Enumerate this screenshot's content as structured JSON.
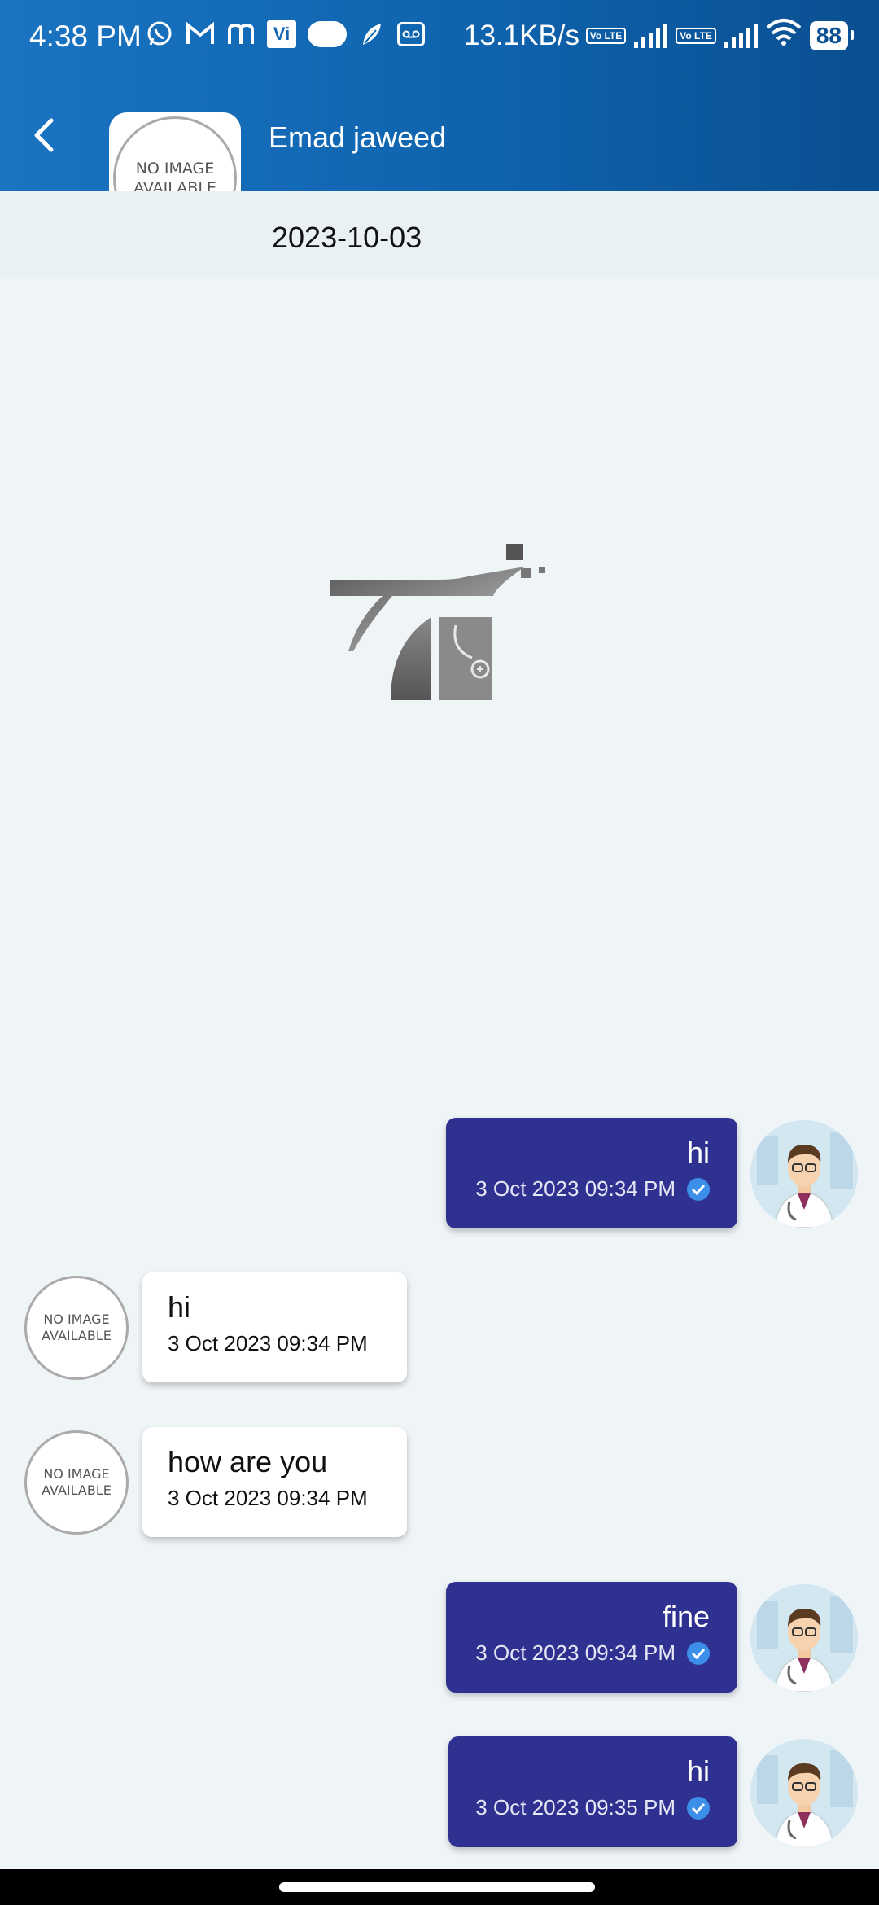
{
  "status": {
    "time": "4:38 PM",
    "network_speed": "13.1KB/s",
    "battery": "88",
    "vi_label": "Vi",
    "volte_label": "Vo LTE",
    "icons": [
      "whatsapp-icon",
      "gmail-icon",
      "m-app-icon",
      "vi-icon",
      "pill-icon",
      "feather-icon",
      "voicemail-icon",
      "volte-icon",
      "signal-icon",
      "wifi-icon",
      "battery-icon"
    ]
  },
  "header": {
    "back_icon": "chevron-left-icon",
    "contact_name": "Emad jaweed",
    "avatar_placeholder_line1": "NO IMAGE",
    "avatar_placeholder_line2": "AVAILABLE",
    "date": "2023-10-03"
  },
  "colors": {
    "header_gradient_start": "#1a74c2",
    "header_gradient_end": "#0a4f91",
    "background": "#eff4f7",
    "outgoing_bubble": "#2e3190",
    "incoming_bubble": "#ffffff",
    "read_check": "#3b8fe8"
  },
  "messages": [
    {
      "direction": "outgoing",
      "text": "hi",
      "time": "3 Oct 2023 09:34 PM",
      "read": true
    },
    {
      "direction": "incoming",
      "text": "hi",
      "time": "3 Oct 2023 09:34 PM"
    },
    {
      "direction": "incoming",
      "text": "how are you",
      "time": "3 Oct 2023 09:34 PM"
    },
    {
      "direction": "outgoing",
      "text": "fine",
      "time": "3 Oct 2023 09:34 PM",
      "read": true
    },
    {
      "direction": "outgoing",
      "text": "hi",
      "time": "3 Oct 2023 09:35 PM",
      "read": true
    }
  ],
  "incoming_avatar": {
    "line1": "NO IMAGE",
    "line2": "AVAILABLE"
  }
}
